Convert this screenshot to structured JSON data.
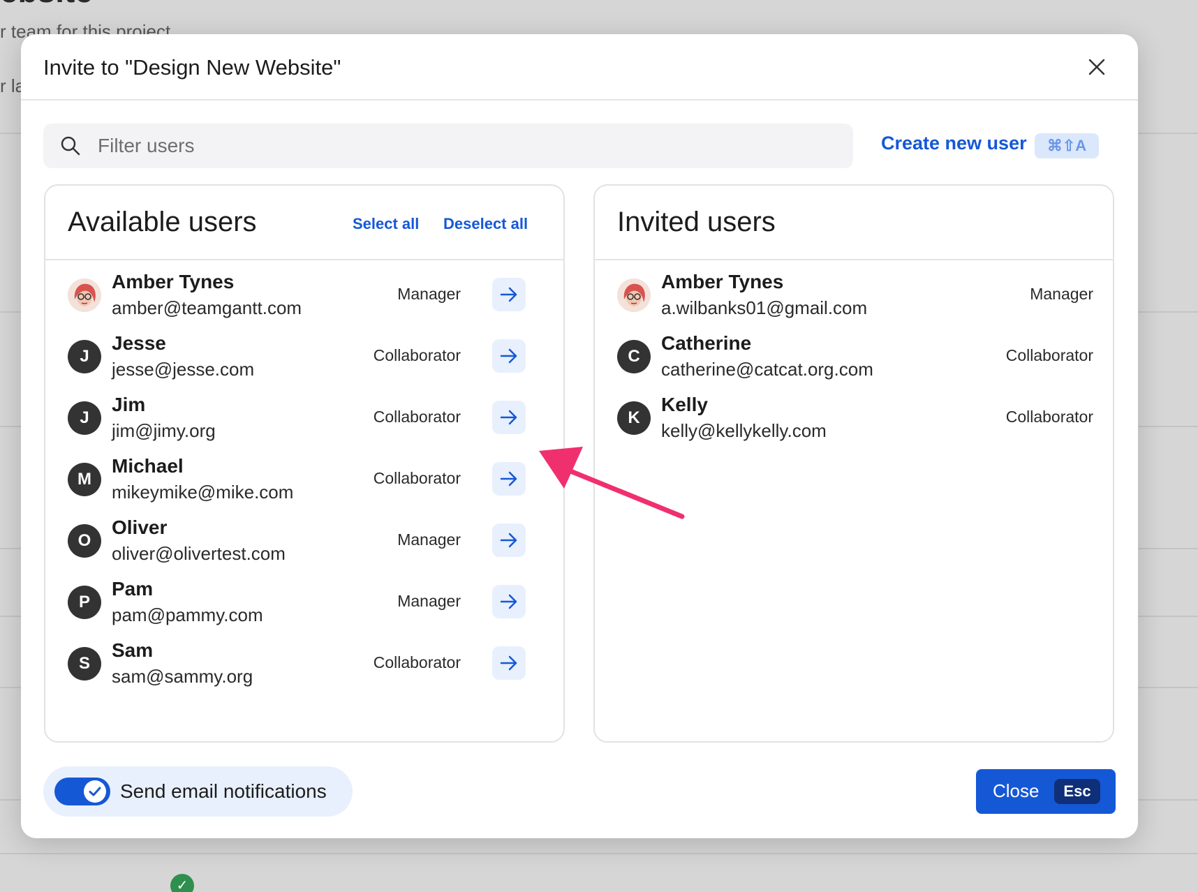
{
  "background": {
    "title_fragment": "ebsite",
    "subtitle_fragment": "r team for this project",
    "label_fragment": "r la"
  },
  "modal": {
    "title": "Invite to \"Design New Website\"",
    "close_icon": "close-icon"
  },
  "search": {
    "placeholder": "Filter users",
    "value": ""
  },
  "create_user": {
    "label": "Create new user",
    "shortcut": "⌘⇧A"
  },
  "available": {
    "title": "Available users",
    "select_all": "Select all",
    "deselect_all": "Deselect all",
    "users": [
      {
        "initial": "",
        "name": "Amber Tynes",
        "email": "amber@teamgantt.com",
        "role": "Manager",
        "photo": true
      },
      {
        "initial": "J",
        "name": "Jesse",
        "email": "jesse@jesse.com",
        "role": "Collaborator"
      },
      {
        "initial": "J",
        "name": "Jim",
        "email": "jim@jimy.org",
        "role": "Collaborator"
      },
      {
        "initial": "M",
        "name": "Michael",
        "email": "mikeymike@mike.com",
        "role": "Collaborator"
      },
      {
        "initial": "O",
        "name": "Oliver",
        "email": "oliver@olivertest.com",
        "role": "Manager"
      },
      {
        "initial": "P",
        "name": "Pam",
        "email": "pam@pammy.com",
        "role": "Manager"
      },
      {
        "initial": "S",
        "name": "Sam",
        "email": "sam@sammy.org",
        "role": "Collaborator"
      }
    ]
  },
  "invited": {
    "title": "Invited users",
    "users": [
      {
        "initial": "",
        "name": "Amber Tynes",
        "email": "a.wilbanks01@gmail.com",
        "role": "Manager",
        "photo": true
      },
      {
        "initial": "C",
        "name": "Catherine",
        "email": "catherine@catcat.org.com",
        "role": "Collaborator"
      },
      {
        "initial": "K",
        "name": "Kelly",
        "email": "kelly@kellykelly.com",
        "role": "Collaborator"
      }
    ]
  },
  "footer": {
    "notifications_label": "Send email notifications",
    "notifications_on": true,
    "close_label": "Close",
    "close_shortcut": "Esc"
  },
  "colors": {
    "accent": "#1558d6",
    "annotation": "#f0306e"
  }
}
